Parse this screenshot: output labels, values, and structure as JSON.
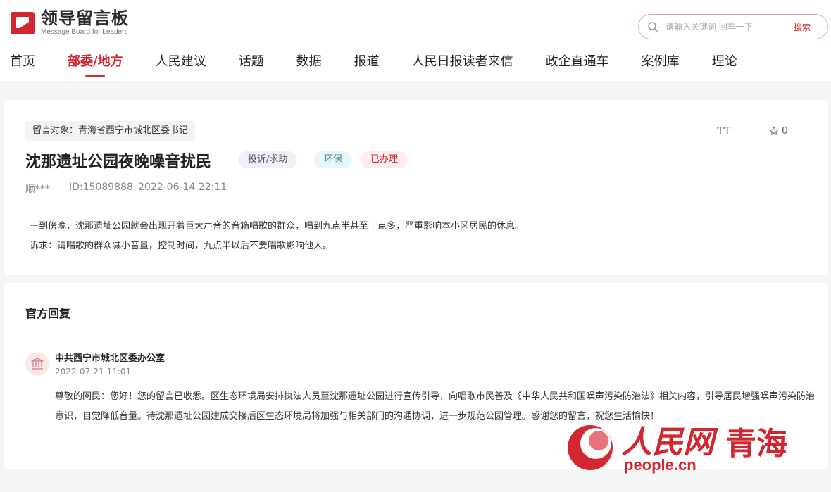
{
  "header": {
    "logo_title": "领导留言板",
    "logo_subtitle": "Message Board for Leaders",
    "search": {
      "placeholder": "请输入关键词 回车一下",
      "button": "搜索"
    },
    "nav": [
      {
        "label": "首页",
        "active": false
      },
      {
        "label": "部委/地方",
        "active": true
      },
      {
        "label": "人民建议",
        "active": false
      },
      {
        "label": "话题",
        "active": false
      },
      {
        "label": "数据",
        "active": false
      },
      {
        "label": "报道",
        "active": false
      },
      {
        "label": "人民日报读者来信",
        "active": false
      },
      {
        "label": "政企直通车",
        "active": false
      },
      {
        "label": "案例库",
        "active": false
      },
      {
        "label": "理论",
        "active": false
      }
    ]
  },
  "message": {
    "target": "留言对象：青海省西宁市城北区委书记",
    "title": "沈那遗址公园夜晚噪音扰民",
    "badges": {
      "type": "投诉/求助",
      "field": "环保",
      "status": "已办理"
    },
    "font_toggle": "TT",
    "favorites": "0",
    "user": "顺***",
    "id": "ID:15089888",
    "time": "2022-06-14 22:11",
    "content_lines": [
      "一到傍晚，沈那遗址公园就会出现开着巨大声音的音箱唱歌的群众，唱到九点半甚至十点多，严重影响本小区居民的休息。",
      "诉求：请唱歌的群众减小音量，控制时间，九点半以后不要唱歌影响他人。"
    ]
  },
  "reply": {
    "section_title": "官方回复",
    "org_name": "中共西宁市城北区委办公室",
    "time": "2022-07-21 11:01",
    "content": "尊敬的网民：您好！您的留言已收悉。区生态环境局安排执法人员至沈那遗址公园进行宣传引导，向唱歌市民普及《中华人民共和国噪声污染防治法》相关内容，引导居民增强噪声污染防治意识，自觉降低音量。待沈那遗址公园建成交接后区生态环境局将加强与相关部门的沟通协调，进一步规范公园管理。感谢您的留言，祝您生活愉快！"
  },
  "watermark": {
    "brand": "人民网",
    "region": "青海",
    "url": "people.cn"
  },
  "colors": {
    "accent": "#d22630",
    "background": "#f4f5f7"
  }
}
